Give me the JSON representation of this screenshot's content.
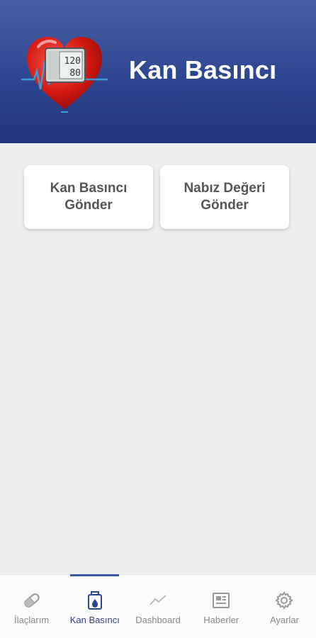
{
  "header": {
    "title": "Kan Basıncı",
    "logo": {
      "name": "heart-blood-pressure-logo",
      "display_top": "120",
      "display_bottom": "80"
    }
  },
  "actions": [
    {
      "line1": "Kan Basıncı",
      "line2": "Gönder"
    },
    {
      "line1": "Nabız Değeri",
      "line2": "Gönder"
    }
  ],
  "bottom_nav": {
    "active_index": 1,
    "items": [
      {
        "label": "İlaçlarım",
        "icon": "pill-icon"
      },
      {
        "label": "Kan Basıncı",
        "icon": "blood-bag-icon"
      },
      {
        "label": "Dashboard",
        "icon": "chart-line-icon"
      },
      {
        "label": "Haberler",
        "icon": "newspaper-icon"
      },
      {
        "label": "Ayarlar",
        "icon": "gear-icon"
      }
    ]
  },
  "colors": {
    "header_top": "#4760a6",
    "header_bottom": "#1f3479",
    "accent": "#2d4690",
    "inactive": "#888888"
  }
}
